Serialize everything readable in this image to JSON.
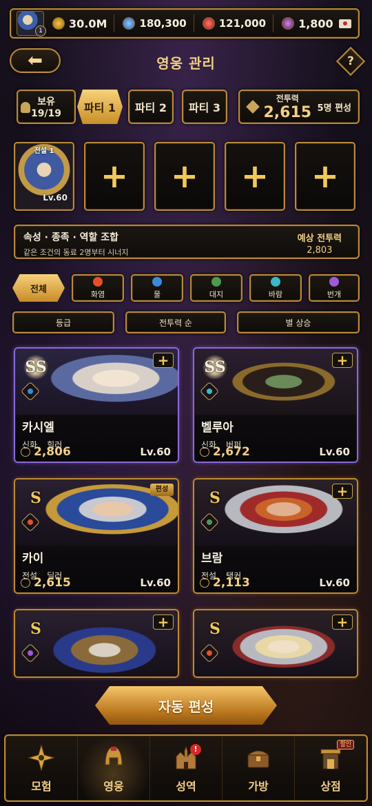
{
  "resources": {
    "gold": "30.0M",
    "gem": "180,300",
    "ruby": "121,000",
    "soul": "1,800",
    "avatar_level": "1"
  },
  "header": {
    "title": "영웅 관리",
    "help": "?"
  },
  "party": {
    "owned_label": "보유",
    "owned_count": "19/19",
    "tabs": [
      "파티 1",
      "파티 2",
      "파티 3"
    ],
    "power_label": "전투력",
    "power_value": "2,615",
    "formation_label": "5명 편성"
  },
  "slots": {
    "first_caption": "전설 1",
    "first_level": "Lv.60",
    "plus": "+"
  },
  "synergy": {
    "title": "속성 · 종족 · 역할 조합",
    "subtitle": "같은 조건의 동료 2명부터 시너지",
    "expected_label": "예상 전투력",
    "expected_value": "2,803"
  },
  "filters": {
    "all": "전체",
    "elements": [
      {
        "label": "화염",
        "color": "#e2502a"
      },
      {
        "label": "물",
        "color": "#3a8ad8"
      },
      {
        "label": "대지",
        "color": "#4c9a52"
      },
      {
        "label": "바람",
        "color": "#3ab8c8"
      },
      {
        "label": "번개",
        "color": "#a05ad8"
      }
    ],
    "sorts": [
      "등급",
      "전투력 순",
      "별 상승"
    ]
  },
  "heroes": [
    {
      "grade": "SS",
      "name": "카시엘",
      "rarity": "신화",
      "role": "힐러",
      "power": "2,806",
      "level": "Lv.60",
      "element_color": "#3a8ad8",
      "action": "+"
    },
    {
      "grade": "SS",
      "name": "벨루아",
      "rarity": "신화",
      "role": "버퍼",
      "power": "2,672",
      "level": "Lv.60",
      "element_color": "#3ab8c8",
      "action": "+"
    },
    {
      "grade": "S",
      "name": "카이",
      "rarity": "전설",
      "role": "딜러",
      "power": "2,615",
      "level": "Lv.60",
      "element_color": "#e2502a",
      "badge": "편성"
    },
    {
      "grade": "S",
      "name": "브람",
      "rarity": "전설",
      "role": "탱커",
      "power": "2,113",
      "level": "Lv.60",
      "element_color": "#4c9a52",
      "action": "+"
    },
    {
      "grade": "S",
      "element_color": "#a05ad8",
      "action": "+"
    },
    {
      "grade": "S",
      "element_color": "#e2502a",
      "action": "+"
    }
  ],
  "auto_button": "자동 편성",
  "nav": [
    {
      "label": "모험",
      "icon": "compass-icon"
    },
    {
      "label": "영웅",
      "icon": "helmet-icon"
    },
    {
      "label": "성역",
      "icon": "castle-icon",
      "alert": "!"
    },
    {
      "label": "가방",
      "icon": "chest-icon"
    },
    {
      "label": "상점",
      "icon": "shop-icon",
      "tag": "할인"
    }
  ]
}
